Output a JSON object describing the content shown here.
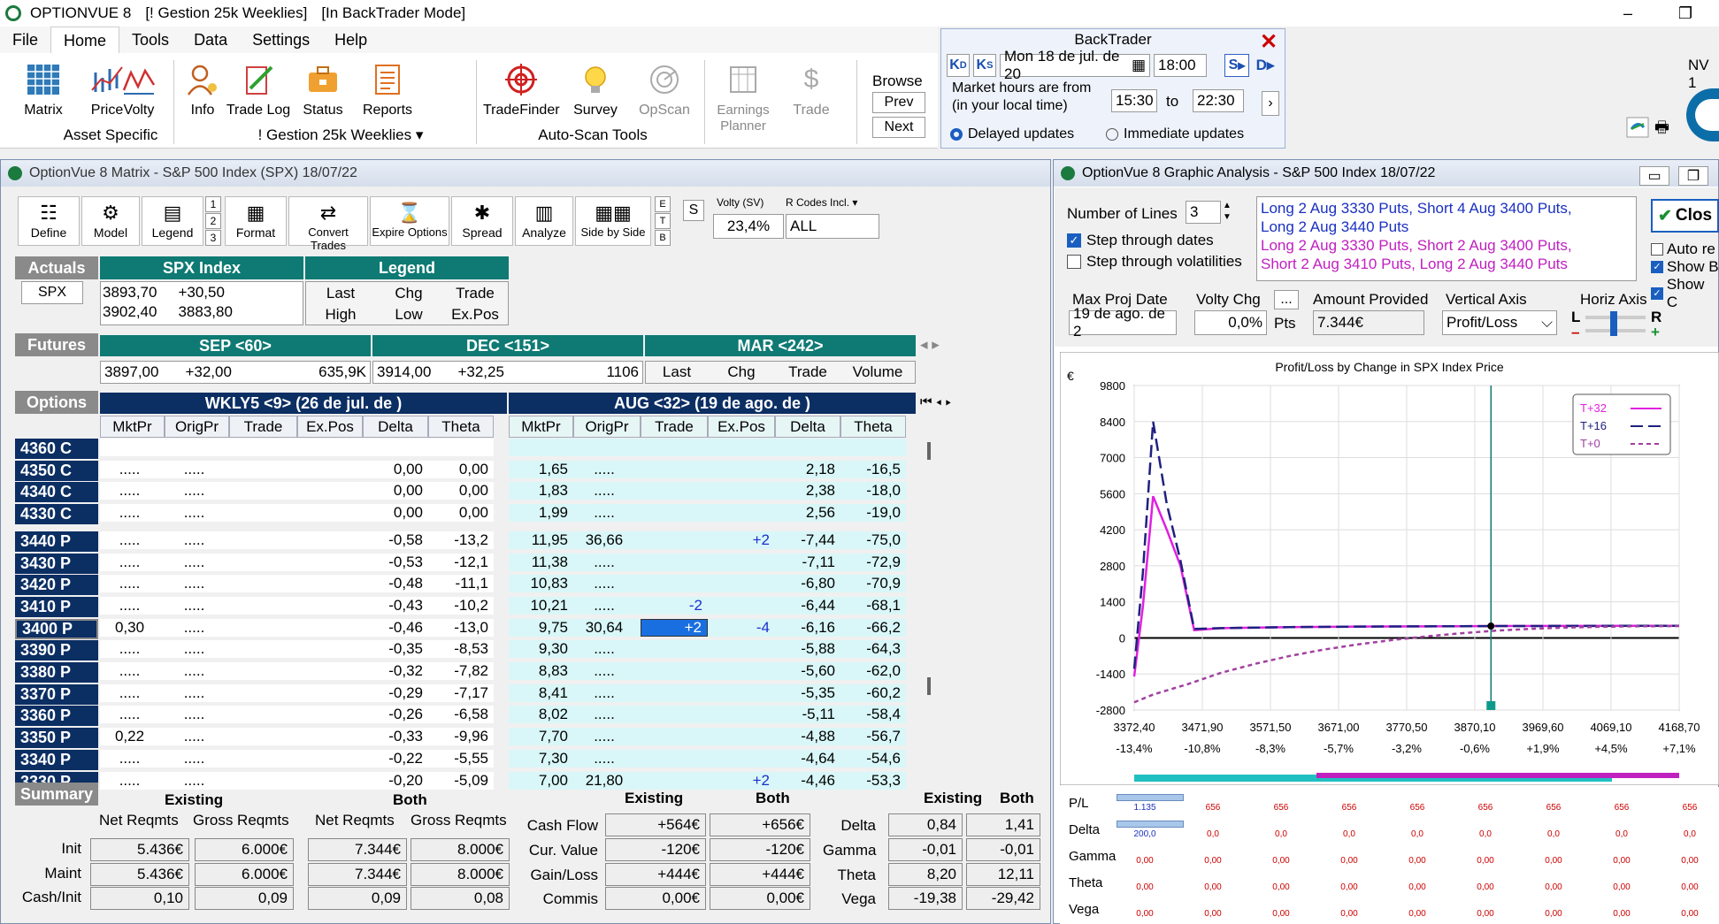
{
  "app": {
    "title": "OPTIONVUE 8",
    "portfolio": "[! Gestion 25k Weeklies]",
    "mode": "[In BackTrader Mode]",
    "min": "–",
    "restore": "❐"
  },
  "menu": [
    "File",
    "Home",
    "Tools",
    "Data",
    "Settings",
    "Help"
  ],
  "ribbon": {
    "buttons": [
      {
        "label": "Matrix",
        "icon": "matrix-icon"
      },
      {
        "label": "Price",
        "icon": "price-chart-icon"
      },
      {
        "label": "Volty",
        "icon": "volatility-icon"
      },
      {
        "label": "Info",
        "icon": "info-person-icon"
      },
      {
        "label": "Trade Log",
        "icon": "trade-log-icon"
      },
      {
        "label": "Status",
        "icon": "status-briefcase-icon"
      },
      {
        "label": "Reports",
        "icon": "reports-icon"
      },
      {
        "label": "TradeFinder",
        "icon": "target-icon"
      },
      {
        "label": "Survey",
        "icon": "lightbulb-icon"
      },
      {
        "label": "OpScan",
        "icon": "radar-icon"
      },
      {
        "label": "Earnings Planner",
        "icon": "planner-icon"
      },
      {
        "label": "Trade",
        "icon": "trade-dollar-icon"
      }
    ],
    "groups": {
      "asset": "Asset Specific",
      "portfolio": "! Gestion 25k Weeklies",
      "autoscan": "Auto-Scan Tools"
    },
    "browse": {
      "label": "Browse",
      "prev": "Prev",
      "next": "Next"
    },
    "nv": "NV 1"
  },
  "backtrader": {
    "title": "BackTrader",
    "date": "Mon 18 de jul. de 20",
    "time": "18:00",
    "market_hours_label": "Market hours are from",
    "local_time": "(in your local time)",
    "from": "15:30",
    "to_label": "to",
    "to": "22:30",
    "delayed": "Delayed updates",
    "immediate": "Immediate updates",
    "kd": "K",
    "ks": "K",
    "sbtn": "S",
    "dbtn": "D"
  },
  "matrix": {
    "title": "OptionVue 8 Matrix - S&P 500 Index (SPX) 18/07/22",
    "toolbar": [
      "Define",
      "Model",
      "Legend",
      "Format",
      "Convert Trades",
      "Expire Options",
      "Spread",
      "Analyze",
      "Side by Side"
    ],
    "steps": [
      "1",
      "2",
      "3"
    ],
    "etb": [
      "E",
      "T",
      "B"
    ],
    "s": "S",
    "volty_label": "Volty (SV)",
    "volty": "23,4%",
    "rcodes_label": "R Codes Incl.",
    "rcodes": "ALL",
    "actuals": {
      "label": "Actuals",
      "symbol": "SPX",
      "index_label": "SPX Index",
      "legend_label": "Legend",
      "last": "3893,70",
      "chg": "+30,50",
      "high": "3902,40",
      "low": "3883,80",
      "legend": [
        "Last",
        "Chg",
        "Trade",
        "High",
        "Low",
        "Ex.Pos"
      ]
    },
    "futures": {
      "label": "Futures",
      "sep": "SEP <60>",
      "dec": "DEC <151>",
      "mar": "MAR <242>",
      "sep_last": "3897,00",
      "sep_chg": "+32,00",
      "sep_vol": "635,9K",
      "dec_last": "3914,00",
      "dec_chg": "+32,25",
      "dec_vol": "1106",
      "cols": [
        "Last",
        "Chg",
        "Trade",
        "Volume"
      ]
    },
    "options": {
      "label": "Options",
      "wkly": "WKLY5 <9> (26 de jul. de )",
      "aug": "AUG <32> (19 de ago. de )",
      "cols": [
        "MktPr",
        "OrigPr",
        "Trade",
        "Ex.Pos",
        "Delta",
        "Theta",
        "MktPr",
        "OrigPr",
        "Trade",
        "Ex.Pos",
        "Delta",
        "Theta"
      ],
      "calls": [
        {
          "strike": "4360 C",
          "w": [
            "",
            "",
            "",
            "",
            "",
            ""
          ],
          "a": [
            "",
            "",
            "",
            "",
            "",
            ""
          ]
        },
        {
          "strike": "4350 C",
          "w": [
            ".....",
            ".....",
            "",
            "",
            "0,00",
            "0,00"
          ],
          "a": [
            "1,65",
            ".....",
            "",
            "",
            "2,18",
            "-16,5"
          ]
        },
        {
          "strike": "4340 C",
          "w": [
            ".....",
            ".....",
            "",
            "",
            "0,00",
            "0,00"
          ],
          "a": [
            "1,83",
            ".....",
            "",
            "",
            "2,38",
            "-18,0"
          ]
        },
        {
          "strike": "4330 C",
          "w": [
            ".....",
            ".....",
            "",
            "",
            "0,00",
            "0,00"
          ],
          "a": [
            "1,99",
            ".....",
            "",
            "",
            "2,56",
            "-19,0"
          ]
        }
      ],
      "puts": [
        {
          "strike": "3440 P",
          "w": [
            ".....",
            ".....",
            "",
            "",
            "-0,58",
            "-13,2"
          ],
          "a": [
            "11,95",
            "36,66",
            "",
            "+2",
            "-7,44",
            "-75,0"
          ]
        },
        {
          "strike": "3430 P",
          "w": [
            ".....",
            ".....",
            "",
            "",
            "-0,53",
            "-12,1"
          ],
          "a": [
            "11,38",
            ".....",
            "",
            "",
            "-7,11",
            "-72,9"
          ]
        },
        {
          "strike": "3420 P",
          "w": [
            ".....",
            ".....",
            "",
            "",
            "-0,48",
            "-11,1"
          ],
          "a": [
            "10,83",
            ".....",
            "",
            "",
            "-6,80",
            "-70,9"
          ]
        },
        {
          "strike": "3410 P",
          "w": [
            ".....",
            ".....",
            "",
            "",
            "-0,43",
            "-10,2"
          ],
          "a": [
            "10,21",
            ".....",
            "-2",
            "",
            "-6,44",
            "-68,1"
          ]
        },
        {
          "strike": "3400 P",
          "w": [
            "0,30",
            ".....",
            "",
            "",
            "-0,46",
            "-13,0"
          ],
          "a": [
            "9,75",
            "30,64",
            "+2",
            "-4",
            "-6,16",
            "-66,2"
          ]
        },
        {
          "strike": "3390 P",
          "w": [
            ".....",
            ".....",
            "",
            "",
            "-0,35",
            "-8,53"
          ],
          "a": [
            "9,30",
            ".....",
            "",
            "",
            "-5,88",
            "-64,3"
          ]
        },
        {
          "strike": "3380 P",
          "w": [
            ".....",
            ".....",
            "",
            "",
            "-0,32",
            "-7,82"
          ],
          "a": [
            "8,83",
            ".....",
            "",
            "",
            "-5,60",
            "-62,0"
          ]
        },
        {
          "strike": "3370 P",
          "w": [
            ".....",
            ".....",
            "",
            "",
            "-0,29",
            "-7,17"
          ],
          "a": [
            "8,41",
            ".....",
            "",
            "",
            "-5,35",
            "-60,2"
          ]
        },
        {
          "strike": "3360 P",
          "w": [
            ".....",
            ".....",
            "",
            "",
            "-0,26",
            "-6,58"
          ],
          "a": [
            "8,02",
            ".....",
            "",
            "",
            "-5,11",
            "-58,4"
          ]
        },
        {
          "strike": "3350 P",
          "w": [
            "0,22",
            ".....",
            "",
            "",
            "-0,33",
            "-9,96"
          ],
          "a": [
            "7,70",
            ".....",
            "",
            "",
            "-4,88",
            "-56,7"
          ]
        },
        {
          "strike": "3340 P",
          "w": [
            ".....",
            ".....",
            "",
            "",
            "-0,22",
            "-5,55"
          ],
          "a": [
            "7,30",
            ".....",
            "",
            "",
            "-4,64",
            "-54,6"
          ]
        },
        {
          "strike": "3330 P",
          "w": [
            ".....",
            ".....",
            "",
            "",
            "-0,20",
            "-5,09"
          ],
          "a": [
            "7,00",
            "21,80",
            "",
            "+2",
            "-4,46",
            "-53,3"
          ]
        }
      ]
    },
    "summary": {
      "label": "Summary",
      "existing": "Existing",
      "both": "Both",
      "net": "Net Reqmts",
      "gross": "Gross Reqmts",
      "rows": [
        {
          "label": "Init",
          "v": [
            "5.436€",
            "6.000€",
            "7.344€",
            "8.000€"
          ]
        },
        {
          "label": "Maint",
          "v": [
            "5.436€",
            "6.000€",
            "7.344€",
            "8.000€"
          ]
        },
        {
          "label": "Cash/Init",
          "v": [
            "0,10",
            "0,09",
            "0,09",
            "0,08"
          ]
        }
      ],
      "cash": [
        {
          "label": "Cash Flow",
          "e": "+564€",
          "b": "+656€"
        },
        {
          "label": "Cur. Value",
          "e": "-120€",
          "b": "-120€"
        },
        {
          "label": "Gain/Loss",
          "e": "+444€",
          "b": "+444€"
        },
        {
          "label": "Commis",
          "e": "0,00€",
          "b": "0,00€"
        }
      ],
      "greeks": [
        {
          "label": "Delta",
          "e": "0,84",
          "b": "1,41"
        },
        {
          "label": "Gamma",
          "e": "-0,01",
          "b": "-0,01"
        },
        {
          "label": "Theta",
          "e": "8,20",
          "b": "12,11"
        },
        {
          "label": "Vega",
          "e": "-19,38",
          "b": "-29,42"
        }
      ]
    }
  },
  "graph": {
    "title": "OptionVue 8 Graphic Analysis - S&P 500 Index 18/07/22",
    "lines_label": "Number of Lines",
    "lines": "3",
    "step_dates": "Step through dates",
    "step_vols": "Step through volatilities",
    "positions": [
      "Long 2 Aug 3330 Puts, Short 4 Aug 3400 Puts,",
      "Long 2 Aug 3440 Puts",
      "Long 2 Aug 3330 Puts, Short 2 Aug 3400 Puts,",
      "Short 2 Aug 3410 Puts, Long 2 Aug 3440 Puts"
    ],
    "close": "Clos",
    "auto": "Auto re",
    "showb": "Show B",
    "showc": "Show C",
    "max_proj_label": "Max Proj Date",
    "max_proj": "19 de ago. de 2",
    "volty_chg_label": "Volty Chg",
    "volty_chg": "0,0%",
    "pts": "Pts",
    "amount_label": "Amount Provided",
    "amount": "7.344€",
    "vaxis_label": "Vertical Axis",
    "vaxis": "Profit/Loss",
    "haxis_label": "Horiz Axis",
    "l": "L",
    "r": "R",
    "dots": "...",
    "greek_labels": [
      "P/L",
      "Delta",
      "Gamma",
      "Theta",
      "Vega"
    ],
    "pl_row": [
      "1.135",
      "656",
      "656",
      "656",
      "656",
      "656",
      "656",
      "656",
      "656",
      "656"
    ],
    "delta_row": [
      "200,0",
      "0,0",
      "0,0",
      "0,0",
      "0,0",
      "0,0",
      "0,0",
      "0,0",
      "0,0",
      "0,0"
    ],
    "zero_row": [
      "0,00",
      "0,00",
      "0,00",
      "0,00",
      "0,00",
      "0,00",
      "0,00",
      "0,00",
      "0,00",
      "0,00"
    ]
  },
  "chart_data": {
    "type": "line",
    "title": "Profit/Loss by Change in SPX Index Price",
    "ylabel": "€",
    "ylim": [
      -2800,
      9800
    ],
    "yticks": [
      "9800",
      "8400",
      "7000",
      "5600",
      "4200",
      "2800",
      "1400",
      "0",
      "-1400",
      "-2800"
    ],
    "xticks": [
      "3372,40",
      "3471,90",
      "3571,50",
      "3671,00",
      "3770,50",
      "3870,10",
      "3969,60",
      "4069,10",
      "4168,70"
    ],
    "xticks_pct": [
      "-13,4%",
      "-10,8%",
      "-8,3%",
      "-5,7%",
      "-3,2%",
      "-0,6%",
      "+1,9%",
      "+4,5%",
      "+7,1%"
    ],
    "xlim": [
      3372.4,
      4168.7
    ],
    "current_x": 3893.7,
    "legend": [
      "T+32",
      "T+16",
      "T+0"
    ],
    "series": [
      {
        "name": "T+32",
        "color": "#e020e0",
        "x": [
          3372.4,
          3385,
          3400,
          3420,
          3440,
          3460,
          3500,
          3600,
          3700,
          3800,
          3900,
          4000,
          4100,
          4168.7
        ],
        "y": [
          -1500,
          1200,
          5500,
          4200,
          2800,
          300,
          380,
          420,
          440,
          450,
          460,
          465,
          470,
          470
        ]
      },
      {
        "name": "T+16",
        "color": "#202080",
        "x": [
          3372.4,
          3385,
          3400,
          3420,
          3440,
          3460,
          3500,
          3600,
          3700,
          3800,
          3900,
          4000,
          4100,
          4168.7
        ],
        "y": [
          -1200,
          2500,
          8400,
          5200,
          3000,
          350,
          380,
          420,
          440,
          450,
          460,
          465,
          470,
          470
        ]
      },
      {
        "name": "T+0",
        "color": "#a040a0",
        "x": [
          3372.4,
          3400,
          3450,
          3500,
          3550,
          3600,
          3650,
          3700,
          3750,
          3800,
          3850,
          3900,
          3950,
          4000,
          4050,
          4100,
          4168.7
        ],
        "y": [
          -2500,
          -2200,
          -1800,
          -1350,
          -1000,
          -700,
          -450,
          -250,
          -80,
          60,
          180,
          280,
          350,
          400,
          430,
          450,
          460
        ]
      }
    ]
  }
}
